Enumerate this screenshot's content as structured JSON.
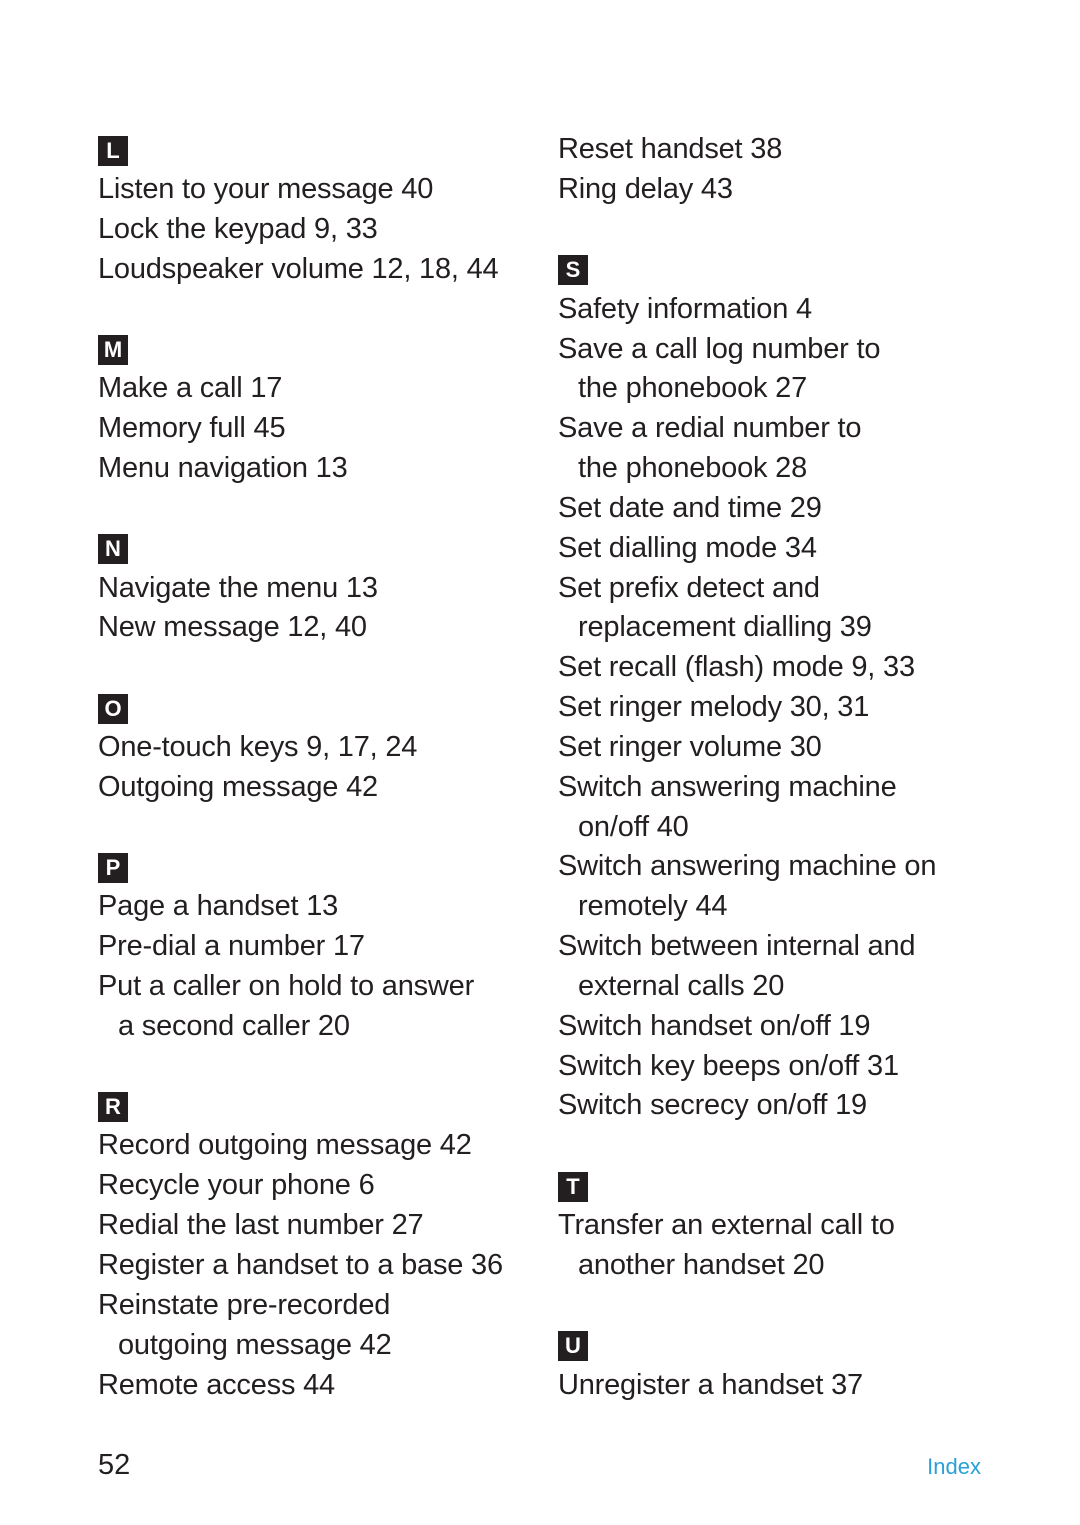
{
  "page": {
    "page_number": "52",
    "section_label": "Index",
    "accent_color": "#2aa0d8"
  },
  "left_column": {
    "L": {
      "letter": "L",
      "entries": [
        "Listen to your message 40",
        "Lock the keypad 9, 33",
        "Loudspeaker volume 12, 18, 44"
      ]
    },
    "M": {
      "letter": "M",
      "entries": [
        "Make a call 17",
        "Memory full 45",
        "Menu navigation 13"
      ]
    },
    "N": {
      "letter": "N",
      "entries": [
        "Navigate the menu 13",
        "New message 12, 40"
      ]
    },
    "O": {
      "letter": "O",
      "entries": [
        "One-touch keys 9, 17, 24",
        "Outgoing message 42"
      ]
    },
    "P": {
      "letter": "P",
      "entries": [
        "Page a handset 13",
        "Pre-dial a number 17",
        "Put a caller on hold to answer",
        "a second caller 20"
      ]
    },
    "R": {
      "letter": "R",
      "entries": [
        "Record outgoing message 42",
        "Recycle your phone 6",
        "Redial the last number 27",
        "Register a handset to a base 36",
        "Reinstate pre-recorded",
        "outgoing message 42",
        "Remote access 44"
      ]
    }
  },
  "right_column": {
    "R_cont": {
      "entries": [
        "Reset handset 38",
        "Ring delay 43"
      ]
    },
    "S": {
      "letter": "S",
      "entries": [
        "Safety information 4",
        "Save a call log number to",
        "the phonebook 27",
        "Save a redial number to",
        "the phonebook 28",
        "Set date and time 29",
        "Set dialling mode 34",
        "Set prefix detect and",
        "replacement dialling 39",
        "Set recall (flash) mode 9, 33",
        "Set ringer melody 30, 31",
        "Set ringer volume 30",
        "Switch answering machine",
        "on/off 40",
        "Switch answering machine on",
        "remotely 44",
        "Switch between internal and",
        "external calls 20",
        "Switch handset on/off 19",
        "Switch key beeps on/off 31",
        "Switch secrecy on/off 19"
      ]
    },
    "T": {
      "letter": "T",
      "entries": [
        "Transfer an external call to",
        "another handset 20"
      ]
    },
    "U": {
      "letter": "U",
      "entries": [
        "Unregister a handset 37"
      ]
    }
  }
}
